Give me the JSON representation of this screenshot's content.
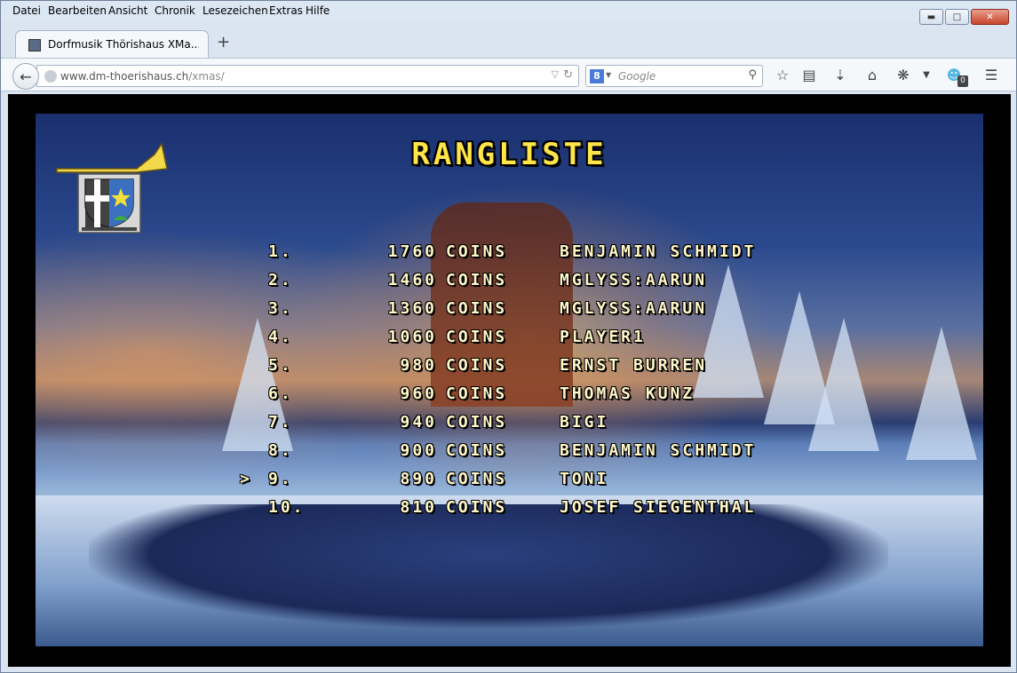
{
  "menu": [
    "Datei",
    "Bearbeiten",
    "Ansicht",
    "Chronik",
    "Lesezeichen",
    "Extras",
    "Hilfe"
  ],
  "tab": {
    "title": "Dorfmusik Thörishaus XMa..."
  },
  "url": {
    "host": "www.dm-thoerishaus.ch",
    "path": "/xmas/"
  },
  "search": {
    "placeholder": "Google",
    "engine_letter": "8"
  },
  "toolbar": {
    "ghostery_badge": "0"
  },
  "game": {
    "title": "RANGLISTE",
    "unit": "COINS",
    "selected_marker": ">",
    "entries": [
      {
        "rank": "1.",
        "score": "1760",
        "name": "BENJAMIN SCHMIDT",
        "selected": false
      },
      {
        "rank": "2.",
        "score": "1460",
        "name": "MGLYSS:AARUN",
        "selected": false
      },
      {
        "rank": "3.",
        "score": "1360",
        "name": "MGLYSS:AARUN",
        "selected": false
      },
      {
        "rank": "4.",
        "score": "1060",
        "name": "PLAYER1",
        "selected": false
      },
      {
        "rank": "5.",
        "score": "980",
        "name": "ERNST BURREN",
        "selected": false
      },
      {
        "rank": "6.",
        "score": "960",
        "name": "THOMAS KUNZ",
        "selected": false
      },
      {
        "rank": "7.",
        "score": "940",
        "name": "BIGI",
        "selected": false
      },
      {
        "rank": "8.",
        "score": "900",
        "name": "BENJAMIN SCHMIDT",
        "selected": false
      },
      {
        "rank": "9.",
        "score": "890",
        "name": "TONI",
        "selected": true
      },
      {
        "rank": "10.",
        "score": "810",
        "name": "JOSEF SIEGENTHAL",
        "selected": false
      }
    ]
  },
  "icons": {
    "back": "back-arrow-icon",
    "star": "bookmark-star-icon",
    "reading": "reading-list-icon",
    "download": "download-icon",
    "home": "home-icon",
    "addon": "addon-icon",
    "ghost": "ghostery-icon",
    "menu": "hamburger-menu-icon"
  }
}
